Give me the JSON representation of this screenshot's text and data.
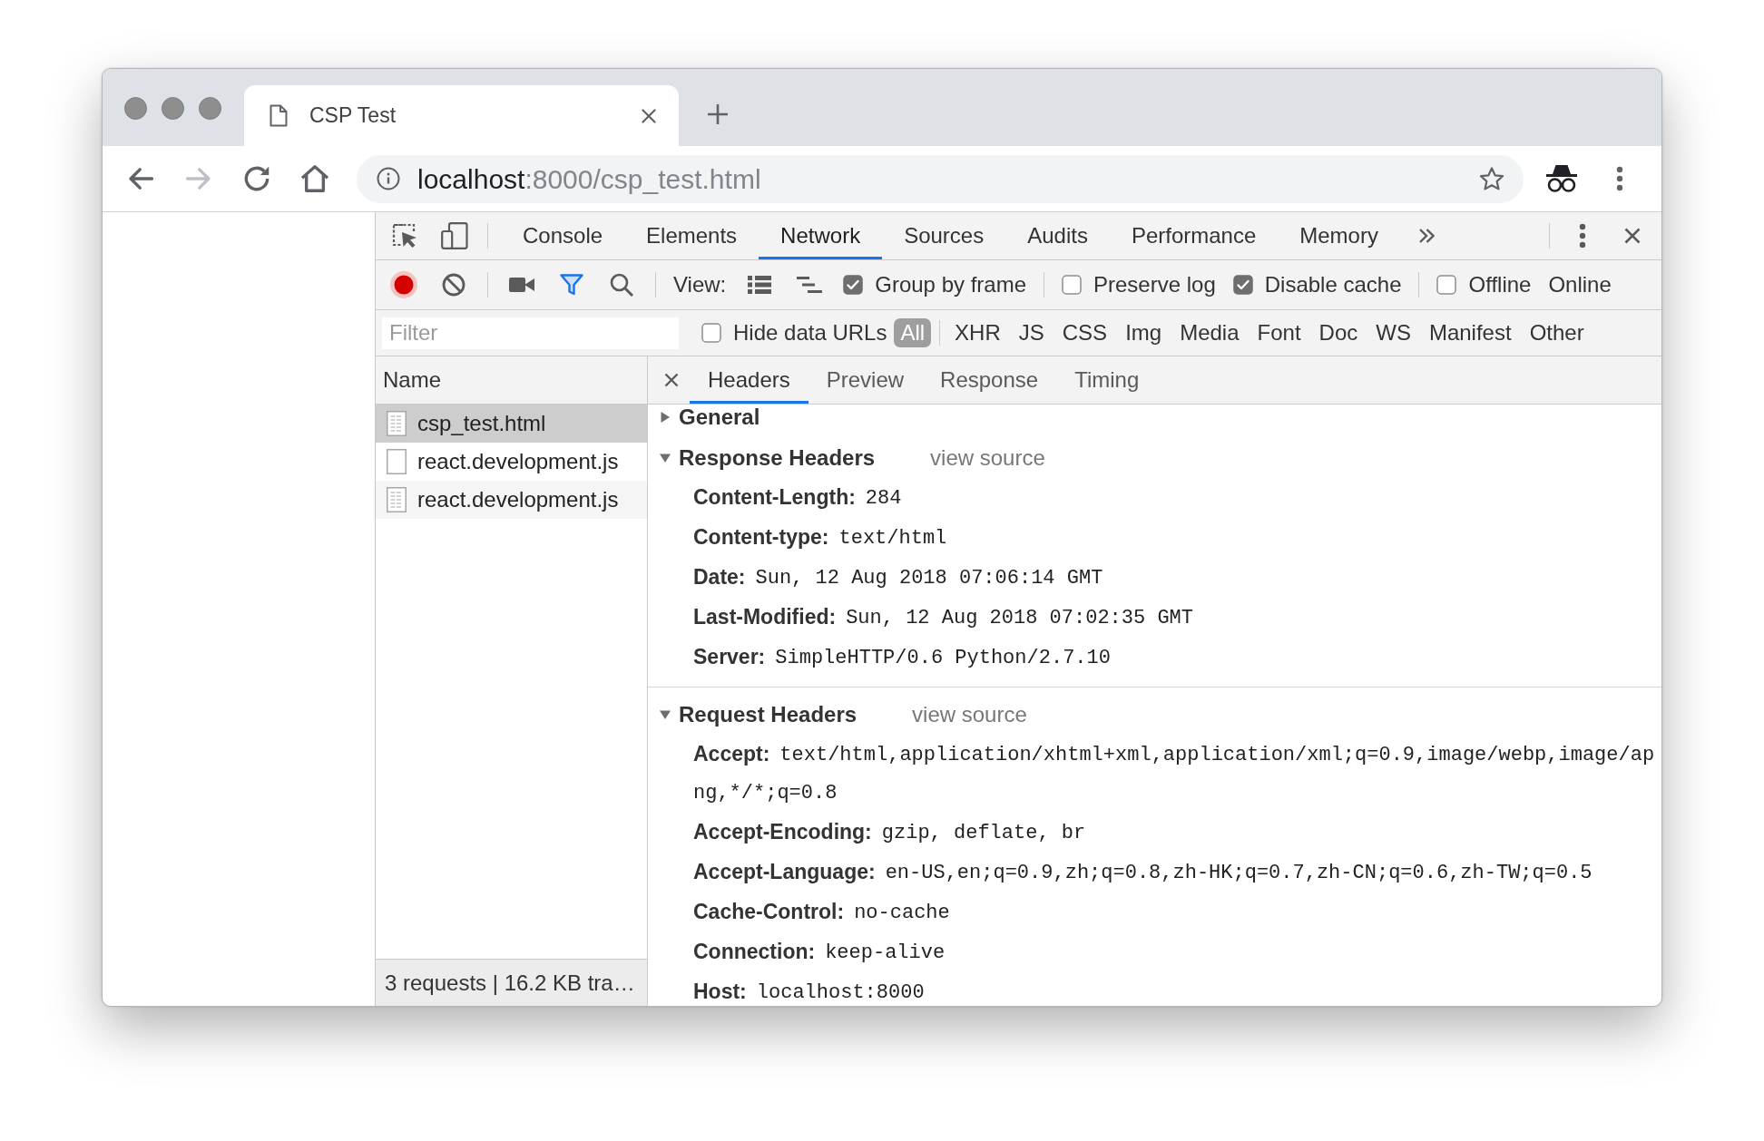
{
  "browser_tab": {
    "title": "CSP Test"
  },
  "toolbar": {
    "nav": [
      {
        "kind": "back",
        "disabled": false
      },
      {
        "kind": "forward",
        "disabled": true
      },
      {
        "kind": "reload",
        "disabled": false
      },
      {
        "kind": "home",
        "disabled": false
      }
    ],
    "address": {
      "host": "localhost",
      "path": ":8000/csp_test.html"
    }
  },
  "devtools": {
    "tabs": [
      {
        "label": "Console",
        "selected": false
      },
      {
        "label": "Elements",
        "selected": false
      },
      {
        "label": "Network",
        "selected": true
      },
      {
        "label": "Sources",
        "selected": false
      },
      {
        "label": "Audits",
        "selected": false
      },
      {
        "label": "Performance",
        "selected": false
      },
      {
        "label": "Memory",
        "selected": false
      }
    ],
    "toolbar": {
      "recording": true,
      "filter_on": true,
      "view_label": "View:",
      "option_groups": [
        [
          {
            "label": "Group by frame",
            "checked": true
          }
        ],
        [
          {
            "label": "Preserve log",
            "checked": false
          },
          {
            "label": "Disable cache",
            "checked": true
          }
        ],
        [
          {
            "label": "Offline",
            "checked": false
          }
        ]
      ],
      "throttling": "Online"
    },
    "filter": {
      "placeholder": "Filter",
      "hide_data_urls": {
        "label": "Hide data URLs",
        "checked": false
      },
      "types": [
        {
          "label": "All",
          "selected": true
        },
        {
          "label": "XHR",
          "selected": false
        },
        {
          "label": "JS",
          "selected": false
        },
        {
          "label": "CSS",
          "selected": false
        },
        {
          "label": "Img",
          "selected": false
        },
        {
          "label": "Media",
          "selected": false
        },
        {
          "label": "Font",
          "selected": false
        },
        {
          "label": "Doc",
          "selected": false
        },
        {
          "label": "WS",
          "selected": false
        },
        {
          "label": "Manifest",
          "selected": false
        },
        {
          "label": "Other",
          "selected": false
        }
      ]
    },
    "requests": {
      "column": "Name",
      "rows": [
        {
          "name": "csp_test.html",
          "kind": "document",
          "selected": true
        },
        {
          "name": "react.development.js",
          "kind": "blank",
          "selected": false
        },
        {
          "name": "react.development.js",
          "kind": "document",
          "selected": false
        }
      ],
      "summary": "3 requests | 16.2 KB tra…"
    },
    "details": {
      "tabs": [
        {
          "label": "Headers",
          "selected": true
        },
        {
          "label": "Preview",
          "selected": false
        },
        {
          "label": "Response",
          "selected": false
        },
        {
          "label": "Timing",
          "selected": false
        }
      ],
      "sections": [
        {
          "title": "General",
          "expanded": false
        },
        {
          "title": "Response Headers",
          "expanded": true,
          "link": "view source",
          "headers": [
            {
              "name": "Content-Length:",
              "value": "284"
            },
            {
              "name": "Content-type:",
              "value": "text/html"
            },
            {
              "name": "Date:",
              "value": "Sun, 12 Aug 2018 07:06:14 GMT"
            },
            {
              "name": "Last-Modified:",
              "value": "Sun, 12 Aug 2018 07:02:35 GMT"
            },
            {
              "name": "Server:",
              "value": "SimpleHTTP/0.6 Python/2.7.10"
            }
          ]
        },
        {
          "title": "Request Headers",
          "expanded": true,
          "link": "view source",
          "headers": [
            {
              "name": "Accept:",
              "value": "text/html,application/xhtml+xml,application/xml;q=0.9,image/webp,image/apng,*/*;q=0.8"
            },
            {
              "name": "Accept-Encoding:",
              "value": "gzip, deflate, br"
            },
            {
              "name": "Accept-Language:",
              "value": "en-US,en;q=0.9,zh;q=0.8,zh-HK;q=0.7,zh-CN;q=0.6,zh-TW;q=0.5"
            },
            {
              "name": "Cache-Control:",
              "value": "no-cache"
            },
            {
              "name": "Connection:",
              "value": "keep-alive"
            },
            {
              "name": "Host:",
              "value": "localhost:8000"
            }
          ]
        }
      ]
    }
  }
}
